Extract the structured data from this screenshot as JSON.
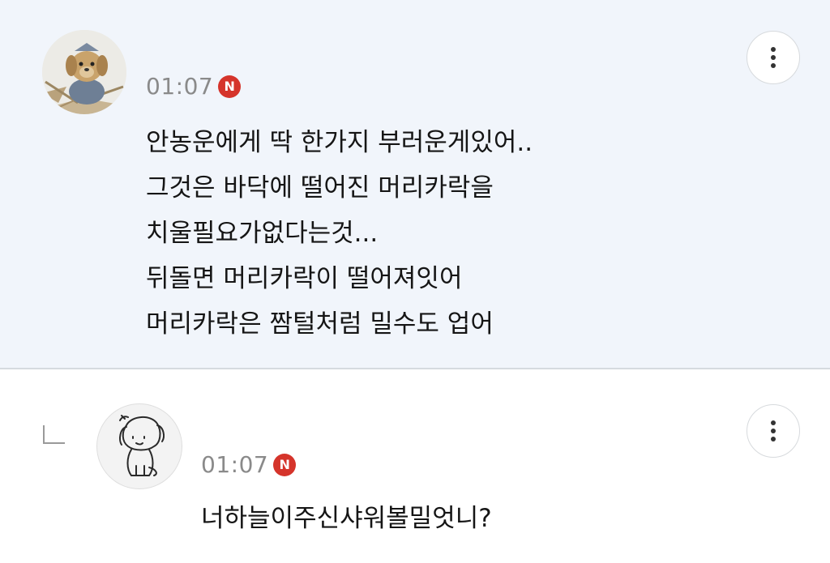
{
  "comment": {
    "time": "01:07",
    "badge": "N",
    "lines": [
      "안농운에게 딱 한가지 부러운게있어..",
      "그것은 바닥에 떨어진 머리카락을",
      "치울필요가없다는것...",
      "뒤돌면 머리카락이 떨어져잇어",
      "머리카락은 짬털처럼 밀수도 업어"
    ],
    "more_icon": "more-vertical-icon"
  },
  "reply": {
    "time": "01:07",
    "badge": "N",
    "text": "너하늘이주신샤워볼밀엇니?",
    "more_icon": "more-vertical-icon",
    "marker_icon": "reply-arrow-icon"
  },
  "colors": {
    "comment_bg": "#f1f5fb",
    "badge_red": "#d5342b",
    "time_gray": "#8a8a8a"
  }
}
